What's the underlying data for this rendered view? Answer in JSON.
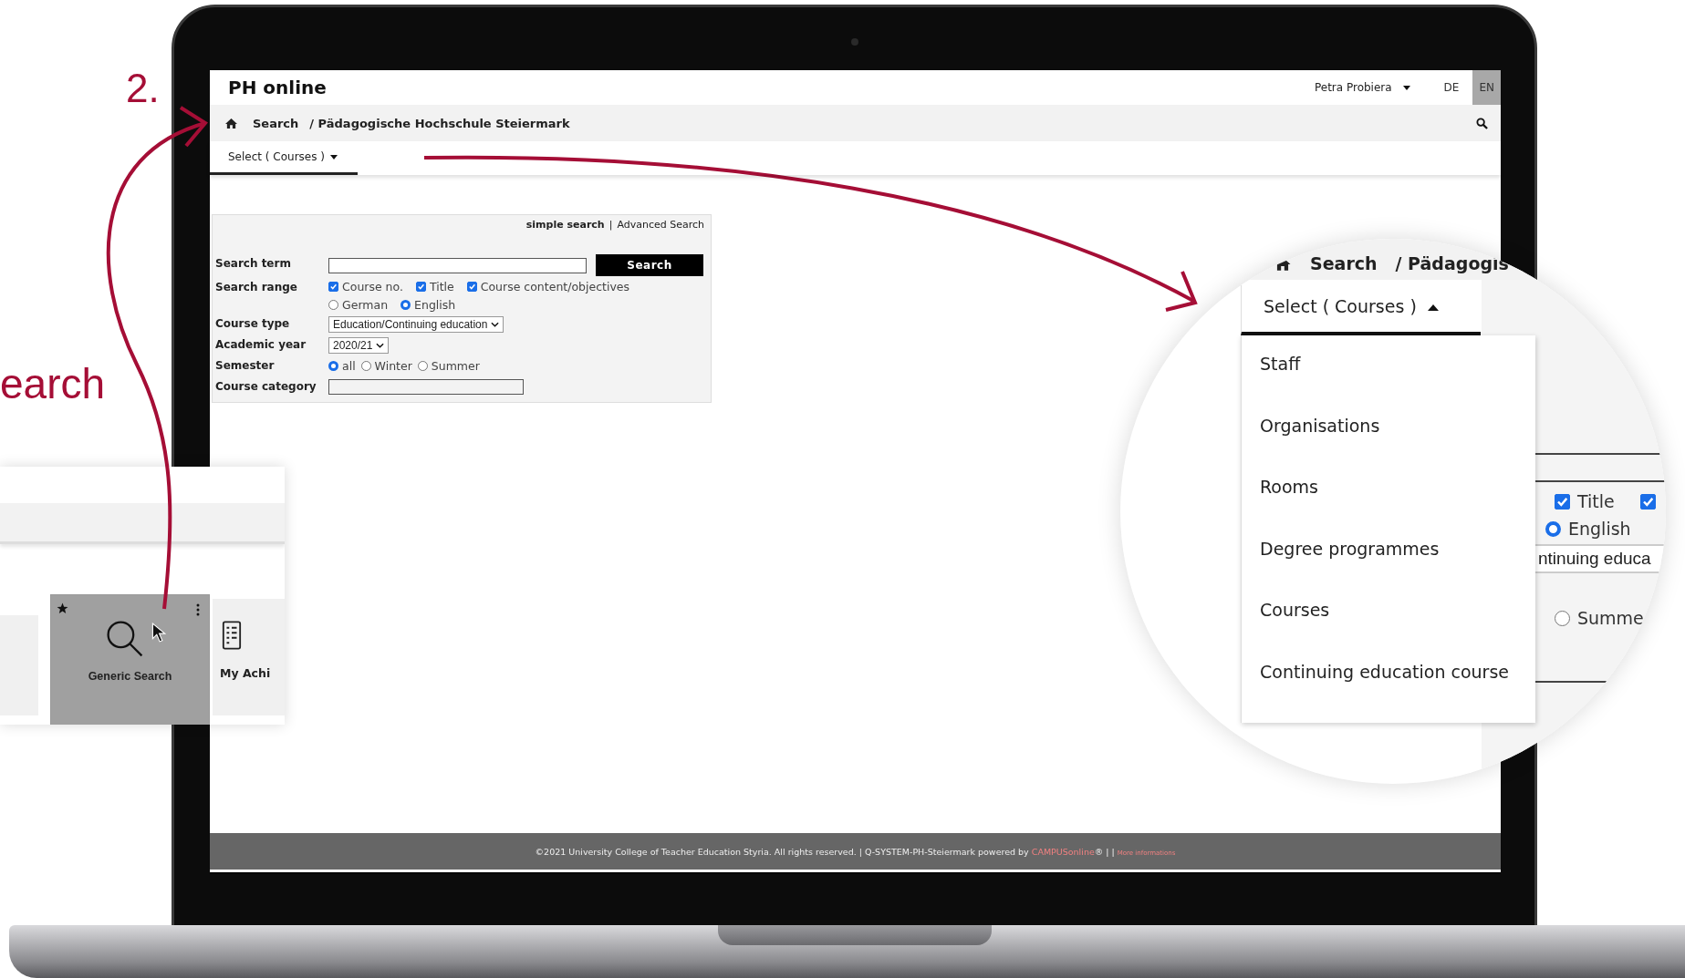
{
  "annotation": {
    "step": "2.",
    "heading": "earch"
  },
  "app": {
    "brand": "PH online",
    "user": "Petra Probiera",
    "languages": [
      {
        "label": "DE",
        "selected": false
      },
      {
        "label": "EN",
        "selected": true
      }
    ],
    "breadcrumb": [
      "Search",
      "/ Pädagogische Hochschule Steiermark"
    ],
    "tab": {
      "label": "Select ( Courses )",
      "expanded": false
    },
    "search_form": {
      "separator": "|",
      "links": [
        {
          "label": "simple search",
          "selected": true
        },
        {
          "label": "Advanced Search",
          "selected": false
        }
      ],
      "rows": [
        {
          "kind": "text",
          "label": "Search term",
          "button": "Search"
        },
        {
          "kind": "checks",
          "label": "Search range",
          "options": [
            {
              "label": "Course no.",
              "checked": true
            },
            {
              "label": "Title",
              "checked": true
            },
            {
              "label": "Course content/objectives",
              "checked": true
            }
          ],
          "radios": [
            {
              "label": "German",
              "selected": false
            },
            {
              "label": "English",
              "selected": true
            }
          ]
        },
        {
          "kind": "select",
          "label": "Course type",
          "value": "Education/Continuing education"
        },
        {
          "kind": "select",
          "label": "Academic year",
          "value": "2020/21"
        },
        {
          "kind": "radios",
          "label": "Semester",
          "radios": [
            {
              "label": "all",
              "selected": true
            },
            {
              "label": "Winter",
              "selected": false
            },
            {
              "label": "Summer",
              "selected": false
            }
          ]
        },
        {
          "kind": "text",
          "label": "Course category"
        }
      ]
    },
    "footer": {
      "text": "©2021 University College of Teacher Education Styria. All rights reserved. | Q-SYSTEM-PH-Steiermark powered by ",
      "link": "CAMPUSonline",
      "suffix": "® | |",
      "more": "More informations"
    }
  },
  "tile_panel": {
    "tiles": [
      {
        "kind": "blank",
        "selected": false
      },
      {
        "kind": "search",
        "label": "Generic Search",
        "selected": true,
        "favorite": true
      },
      {
        "kind": "document",
        "label": "My Achi",
        "selected": false,
        "favorite": false
      }
    ]
  },
  "magnifier": {
    "breadcrumb": [
      "Search",
      "/ Pädagogis"
    ],
    "tab": {
      "label": "Select ( Courses )",
      "expanded": true
    },
    "menu": [
      "Staff",
      "Organisations",
      "Rooms",
      "Degree programmes",
      "Courses",
      "Continuing education course"
    ],
    "fragment": {
      "checks": [
        {
          "label": "Title",
          "checked": true
        },
        {
          "checked": true
        }
      ],
      "english": {
        "label": "English",
        "selected": true
      },
      "course_type": "ntinuing educa",
      "summer": {
        "label": "Summe",
        "selected": false
      }
    }
  }
}
